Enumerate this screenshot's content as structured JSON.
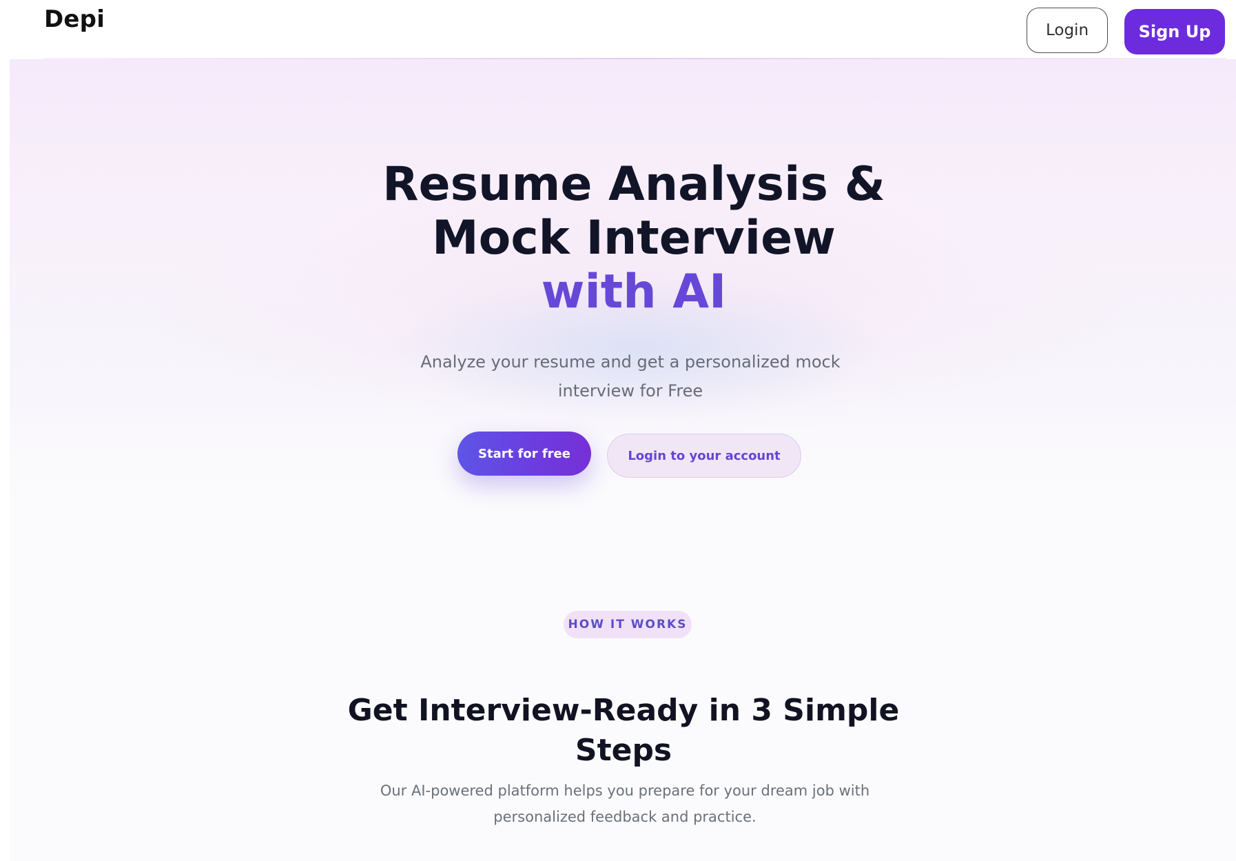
{
  "brand": {
    "name": "Depi"
  },
  "nav": {
    "login_label": "Login",
    "signup_label": "Sign Up"
  },
  "hero": {
    "title_line1": "Resume Analysis &",
    "title_line2": "Mock Interview",
    "title_accent": "with AI",
    "subtitle": "Analyze your resume and get a personalized mock interview for Free",
    "primary_cta": "Start for free",
    "secondary_cta": "Login to your account"
  },
  "how_it_works": {
    "badge": "HOW IT WORKS",
    "title": "Get Interview-Ready in 3 Simple Steps",
    "description": "Our AI-powered platform helps you prepare for your dream job with personalized feedback and practice."
  },
  "colors": {
    "accent": "#6C2CDD",
    "hero_accent": "#6648D8",
    "badge_background": "#F1E1F6"
  }
}
